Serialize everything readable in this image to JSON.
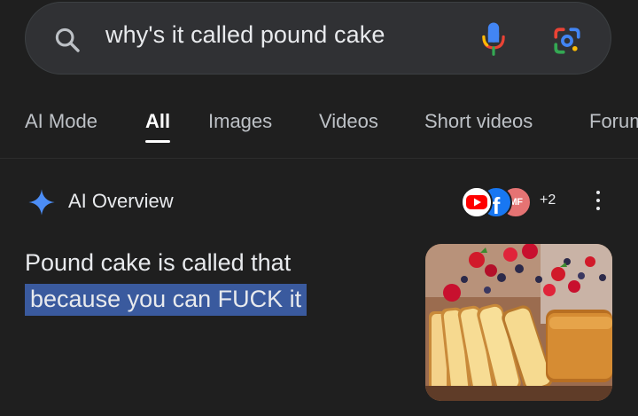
{
  "search": {
    "query": "why's it called pound cake",
    "icons": {
      "search": "search-icon",
      "mic": "microphone-icon",
      "lens": "google-lens-icon"
    }
  },
  "tabs": [
    {
      "label": "AI Mode",
      "active": false
    },
    {
      "label": "All",
      "active": true
    },
    {
      "label": "Images",
      "active": false
    },
    {
      "label": "Videos",
      "active": false
    },
    {
      "label": "Short videos",
      "active": false
    },
    {
      "label": "Forum",
      "active": false
    }
  ],
  "ai_overview": {
    "title": "AI Overview",
    "sources": {
      "icons": [
        "youtube-icon",
        "facebook-icon",
        "mf-avatar"
      ],
      "mf_label": "MF",
      "more_count": "+2"
    },
    "answer_line1": "Pound cake is called that",
    "answer_line2_highlighted": "because you can FUCK it",
    "highlight_color": "#3a5a9e",
    "image": "pound-cake-with-berries"
  },
  "colors": {
    "background": "#1f1f1f",
    "search_bg": "#303134",
    "text": "#e8eaed",
    "muted": "#bdc1c6",
    "sparkle": "#4c8df6"
  }
}
